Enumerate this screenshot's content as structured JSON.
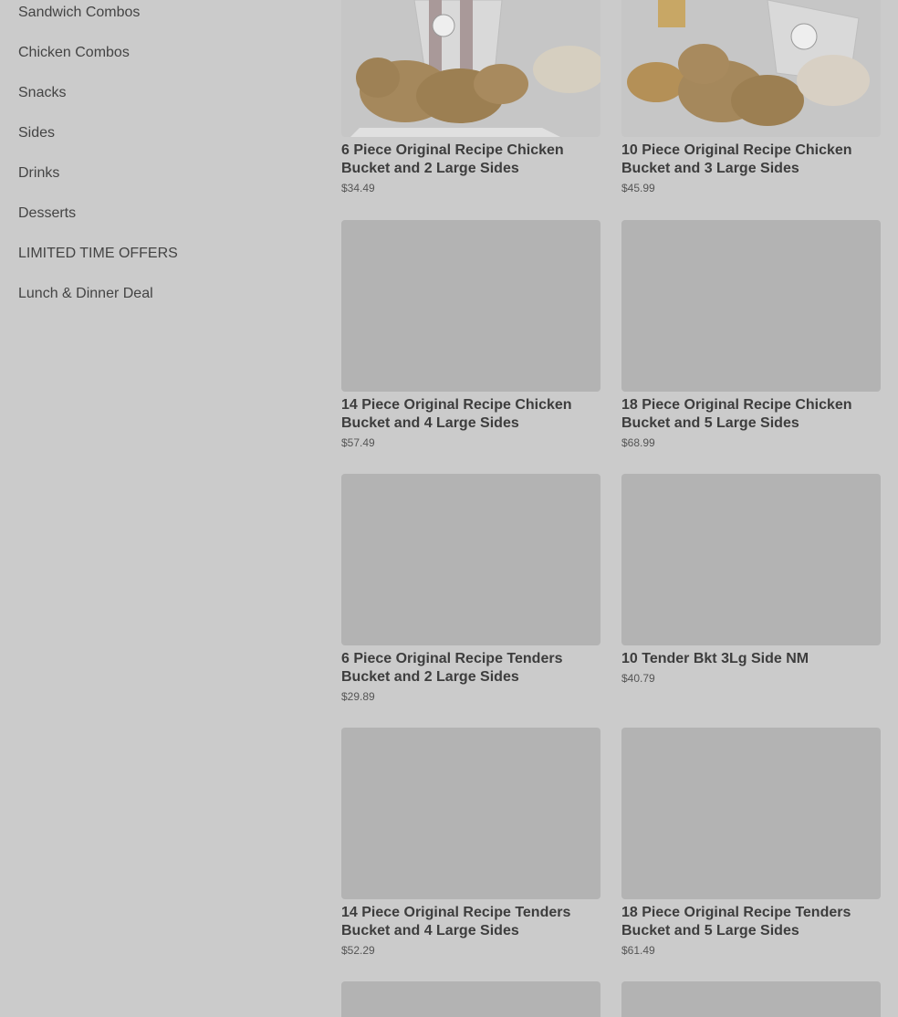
{
  "sidebar": {
    "items": [
      {
        "label": "Sandwich Combos"
      },
      {
        "label": "Chicken Combos"
      },
      {
        "label": "Snacks"
      },
      {
        "label": "Sides"
      },
      {
        "label": "Drinks"
      },
      {
        "label": "Desserts"
      },
      {
        "label": "LIMITED TIME OFFERS"
      },
      {
        "label": "Lunch & Dinner Deal"
      }
    ]
  },
  "menu": {
    "items": [
      {
        "title": "6 Piece Original Recipe Chicken Bucket and 2 Large Sides",
        "price": "$34.49"
      },
      {
        "title": "10 Piece Original Recipe Chicken Bucket and 3 Large Sides",
        "price": "$45.99"
      },
      {
        "title": "14 Piece Original Recipe Chicken Bucket and 4 Large Sides",
        "price": "$57.49"
      },
      {
        "title": "18 Piece Original Recipe Chicken Bucket and 5 Large Sides",
        "price": "$68.99"
      },
      {
        "title": "6 Piece Original Recipe Tenders Bucket and 2 Large Sides",
        "price": "$29.89"
      },
      {
        "title": "10 Tender Bkt 3Lg Side NM",
        "price": "$40.79"
      },
      {
        "title": "14 Piece Original Recipe Tenders Bucket and 4 Large Sides",
        "price": "$52.29"
      },
      {
        "title": "18 Piece Original Recipe Tenders Bucket and 5 Large Sides",
        "price": "$61.49"
      }
    ]
  },
  "colors": {
    "overlay": "#cbcbcb",
    "placeholder": "#b3b3b3"
  }
}
